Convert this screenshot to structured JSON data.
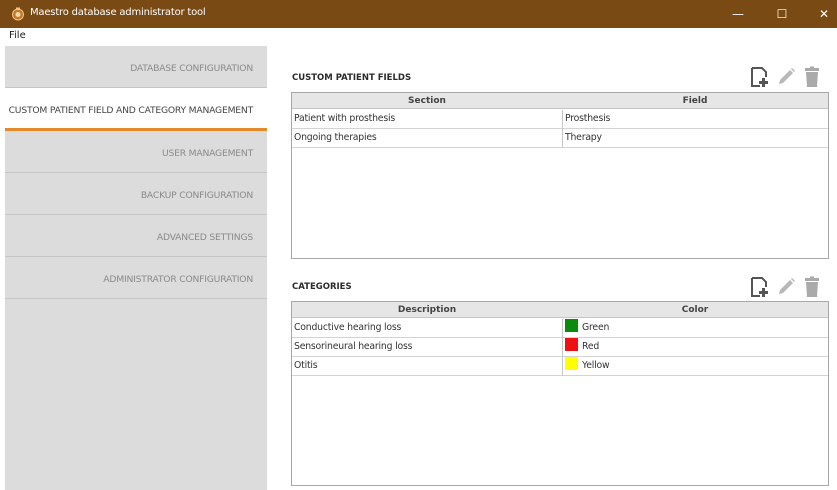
{
  "window": {
    "title": "Maestro database administrator tool",
    "minimize": "—",
    "maximize": "☐",
    "close": "✕",
    "accent": "#7a4a14"
  },
  "menu": {
    "file": "File"
  },
  "sidebar": {
    "items": [
      {
        "label": "DATABASE CONFIGURATION"
      },
      {
        "label": "CUSTOM PATIENT FIELD AND CATEGORY MANAGEMENT",
        "active": true
      },
      {
        "label": "USER MANAGEMENT"
      },
      {
        "label": "BACKUP CONFIGURATION"
      },
      {
        "label": "ADVANCED SETTINGS"
      },
      {
        "label": "ADMINISTRATOR CONFIGURATION"
      }
    ],
    "active_color": "#e58a2a"
  },
  "custom_fields": {
    "title": "CUSTOM PATIENT FIELDS",
    "columns": [
      "Section",
      "Field"
    ],
    "rows": [
      [
        "Patient with prosthesis",
        "Prosthesis"
      ],
      [
        "Ongoing therapies",
        "Therapy"
      ]
    ],
    "icons": [
      "add-file-icon",
      "edit-pencil-icon",
      "delete-trash-icon"
    ]
  },
  "categories": {
    "title": "CATEGORIES",
    "columns": [
      "Description",
      "Color"
    ],
    "rows": [
      {
        "description": "Conductive hearing loss",
        "color": "Green",
        "hex": "#0c8a0c"
      },
      {
        "description": "Sensorineural hearing loss",
        "color": "Red",
        "hex": "#ee1111"
      },
      {
        "description": "Otitis",
        "color": "Yellow",
        "hex": "#ffff00"
      }
    ],
    "icons": [
      "add-file-icon",
      "edit-pencil-icon",
      "delete-trash-icon"
    ]
  }
}
